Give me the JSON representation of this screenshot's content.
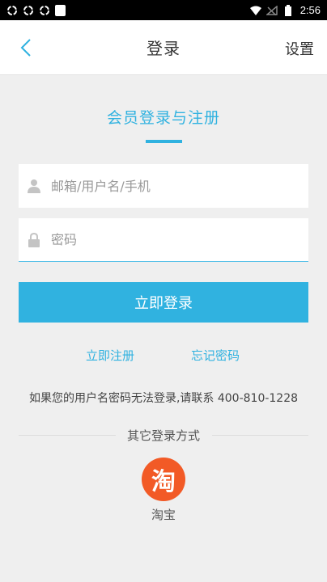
{
  "status_bar": {
    "time": "2:56",
    "left_icons": [
      "sync-icon",
      "sync-icon",
      "sync-icon",
      "notification-square-icon"
    ],
    "right_icons": [
      "wifi-icon",
      "no-signal-icon",
      "battery-icon"
    ]
  },
  "header": {
    "title": "登录",
    "settings_label": "设置"
  },
  "section": {
    "title": "会员登录与注册"
  },
  "form": {
    "username_placeholder": "邮箱/用户名/手机",
    "password_placeholder": "密码",
    "login_label": "立即登录"
  },
  "links": {
    "register_label": "立即注册",
    "forgot_label": "忘记密码"
  },
  "help": {
    "text": "如果您的用户名密码无法登录,请联系 400-810-1228"
  },
  "other_login": {
    "title": "其它登录方式",
    "taobao_glyph": "淘",
    "taobao_label": "淘宝"
  },
  "colors": {
    "accent": "#30b2e0",
    "taobao": "#f25a26",
    "background": "#efefef"
  }
}
